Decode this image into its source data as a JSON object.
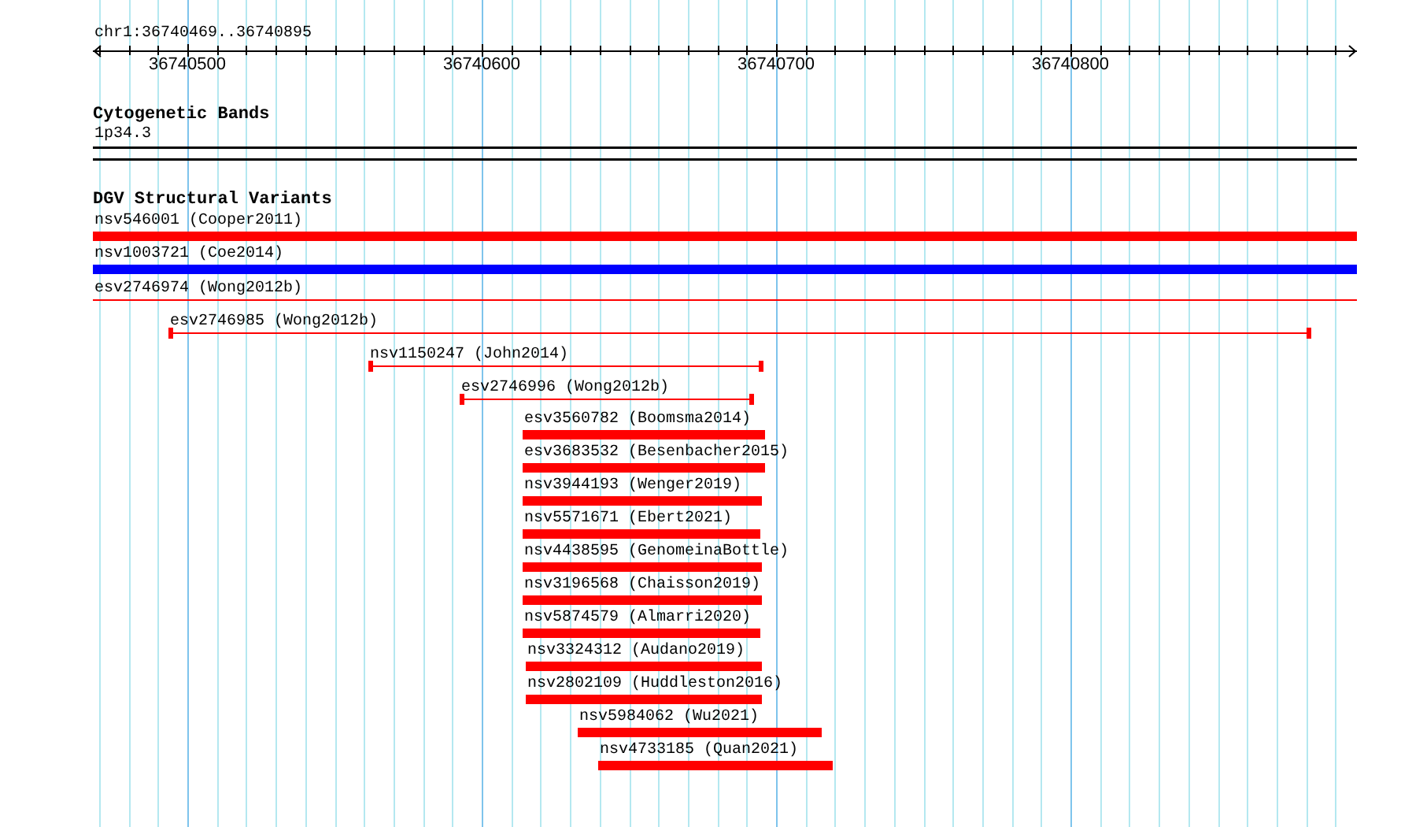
{
  "ruler": {
    "range": "chr1:36740469..36740895",
    "labels": [
      "36740500",
      "36740600",
      "36740700",
      "36740800"
    ]
  },
  "tracks": [
    {
      "title": "Cytogenetic Bands",
      "features": [
        {
          "label": "1p34.3",
          "kind": "band",
          "color": "#000000"
        }
      ]
    },
    {
      "title": "DGV Structural Variants",
      "features": [
        {
          "label": "nsv546001 (Cooper2011)",
          "kind": "bar",
          "color": "#ff0000"
        },
        {
          "label": "nsv1003721 (Coe2014)",
          "kind": "bar",
          "color": "#0000ff"
        },
        {
          "label": "esv2746974 (Wong2012b)",
          "kind": "line",
          "color": "#ff0000"
        },
        {
          "label": "esv2746985 (Wong2012b)",
          "kind": "interval",
          "color": "#ff0000"
        },
        {
          "label": "nsv1150247 (John2014)",
          "kind": "interval",
          "color": "#ff0000"
        },
        {
          "label": "esv2746996 (Wong2012b)",
          "kind": "interval",
          "color": "#ff0000"
        },
        {
          "label": "esv3560782 (Boomsma2014)",
          "kind": "bar",
          "color": "#ff0000"
        },
        {
          "label": "esv3683532 (Besenbacher2015)",
          "kind": "bar",
          "color": "#ff0000"
        },
        {
          "label": "nsv3944193 (Wenger2019)",
          "kind": "bar",
          "color": "#ff0000"
        },
        {
          "label": "nsv5571671 (Ebert2021)",
          "kind": "bar",
          "color": "#ff0000"
        },
        {
          "label": "nsv4438595 (GenomeinaBottle)",
          "kind": "bar",
          "color": "#ff0000"
        },
        {
          "label": "nsv3196568 (Chaisson2019)",
          "kind": "bar",
          "color": "#ff0000"
        },
        {
          "label": "nsv5874579 (Almarri2020)",
          "kind": "bar",
          "color": "#ff0000"
        },
        {
          "label": "nsv3324312 (Audano2019)",
          "kind": "bar",
          "color": "#ff0000"
        },
        {
          "label": "nsv2802109 (Huddleston2016)",
          "kind": "bar",
          "color": "#ff0000"
        },
        {
          "label": "nsv5984062 (Wu2021)",
          "kind": "bar",
          "color": "#ff0000"
        },
        {
          "label": "nsv4733185 (Quan2021)",
          "kind": "bar",
          "color": "#ff0000"
        }
      ]
    }
  ]
}
